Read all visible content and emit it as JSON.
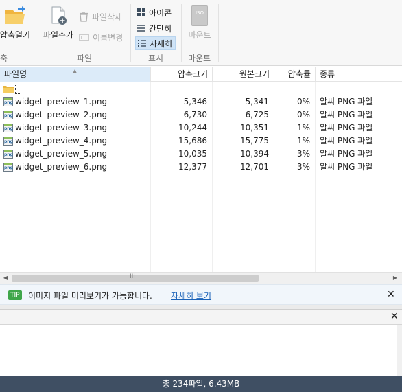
{
  "ribbon": {
    "open_archive": "압축열기",
    "add_file": "파일추가",
    "delete_file": "파일삭제",
    "rename": "이름변경",
    "view_icon": "아이콘",
    "view_simple": "간단히",
    "view_detail": "자세히",
    "mount": "마운트",
    "mount_top": "ISO",
    "group_left_partial": "축",
    "group_file": "파일",
    "group_view": "표시",
    "group_mount": "마운트"
  },
  "columns": {
    "name": "파일명",
    "compressed": "압축크기",
    "original": "원본크기",
    "ratio": "압축률",
    "type": "종류"
  },
  "files": [
    {
      "name": "widget_preview_1.png",
      "compressed": "5,346",
      "original": "5,341",
      "ratio": "0%",
      "type": "알씨 PNG 파일"
    },
    {
      "name": "widget_preview_2.png",
      "compressed": "6,730",
      "original": "6,725",
      "ratio": "0%",
      "type": "알씨 PNG 파일"
    },
    {
      "name": "widget_preview_3.png",
      "compressed": "10,244",
      "original": "10,351",
      "ratio": "1%",
      "type": "알씨 PNG 파일"
    },
    {
      "name": "widget_preview_4.png",
      "compressed": "15,686",
      "original": "15,775",
      "ratio": "1%",
      "type": "알씨 PNG 파일"
    },
    {
      "name": "widget_preview_5.png",
      "compressed": "10,035",
      "original": "10,394",
      "ratio": "3%",
      "type": "알씨 PNG 파일"
    },
    {
      "name": "widget_preview_6.png",
      "compressed": "12,377",
      "original": "12,701",
      "ratio": "3%",
      "type": "알씨 PNG 파일"
    }
  ],
  "icons": {
    "png": "png",
    "scroll_grip": "III"
  },
  "tip": {
    "badge": "TIP",
    "text": "이미지 파일 미리보기가 가능합니다.",
    "link": "자세히 보기"
  },
  "status": {
    "text": "총 234파일,  6.43MB"
  },
  "colors": {
    "status_bg": "#3f4f63",
    "accent_select": "#cfe3f6",
    "link": "#1a62b8",
    "tip_badge": "#3fa64a"
  }
}
